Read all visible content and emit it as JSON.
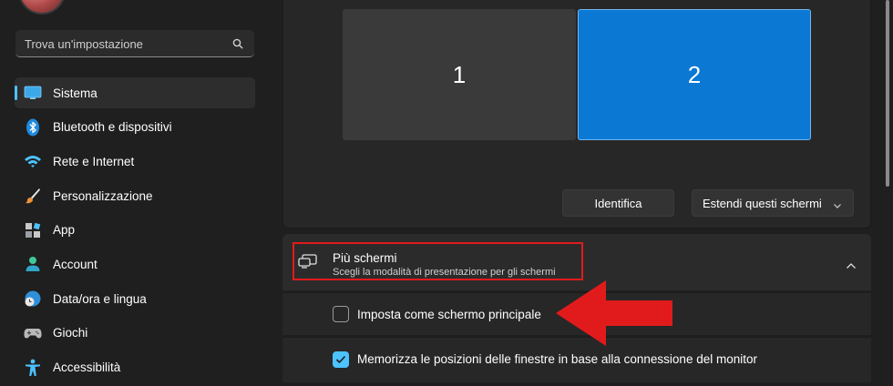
{
  "search": {
    "placeholder": "Trova un'impostazione"
  },
  "sidebar": {
    "items": [
      {
        "label": "Sistema",
        "icon": "display-icon",
        "active": true
      },
      {
        "label": "Bluetooth e dispositivi",
        "icon": "bluetooth-icon"
      },
      {
        "label": "Rete e Internet",
        "icon": "wifi-icon"
      },
      {
        "label": "Personalizzazione",
        "icon": "brush-icon"
      },
      {
        "label": "App",
        "icon": "apps-icon"
      },
      {
        "label": "Account",
        "icon": "person-icon"
      },
      {
        "label": "Data/ora e lingua",
        "icon": "globe-clock-icon"
      },
      {
        "label": "Giochi",
        "icon": "gamepad-icon"
      },
      {
        "label": "Accessibilità",
        "icon": "accessibility-icon"
      }
    ]
  },
  "display": {
    "monitors": [
      {
        "label": "1"
      },
      {
        "label": "2",
        "selected": true
      }
    ],
    "identify_label": "Identifica",
    "extend_select": {
      "value": "Estendi questi schermi"
    }
  },
  "multi_display": {
    "title": "Più schermi",
    "subtitle": "Scegli la modalità di presentazione per gli schermi",
    "options": [
      {
        "label": "Imposta come schermo principale",
        "checked": false
      },
      {
        "label": "Memorizza le posizioni delle finestre in base alla connessione del monitor",
        "checked": true
      }
    ]
  },
  "colors": {
    "accent": "#4cc2ff",
    "selected_monitor": "#0b78d4",
    "annotation_red": "#e11b1b"
  }
}
